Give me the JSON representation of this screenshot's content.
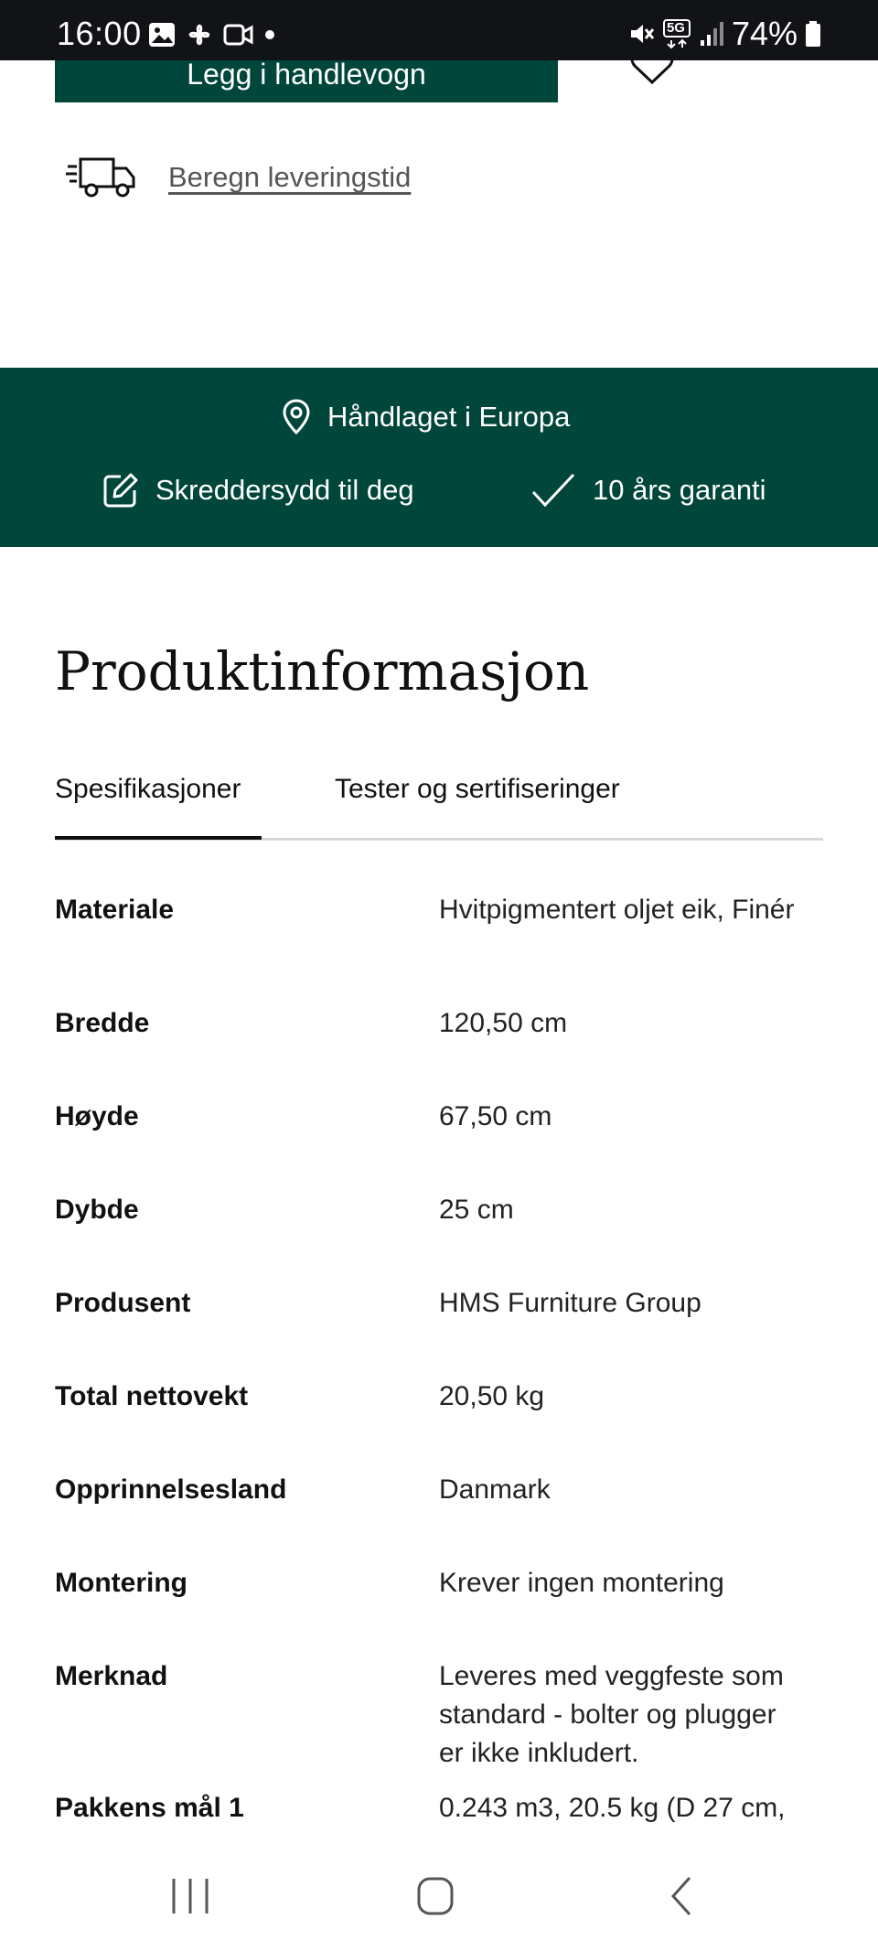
{
  "status_bar": {
    "time": "16:00",
    "battery": "74%",
    "network": "5G"
  },
  "actions": {
    "cart_button_label": "Legg i handlevogn",
    "delivery_link": "Beregn leveringstid"
  },
  "usp": {
    "handmade": "Håndlaget i Europa",
    "tailored": "Skreddersydd til deg",
    "warranty": "10 års garanti"
  },
  "product_info": {
    "title": "Produktinformasjon",
    "tabs": [
      {
        "label": "Spesifikasjoner",
        "active": true
      },
      {
        "label": "Tester og sertifiseringer",
        "active": false
      }
    ],
    "specs": [
      {
        "label": "Materiale",
        "value": "Hvitpigmentert oljet eik, Finér"
      },
      {
        "label": "Bredde",
        "value": "120,50 cm"
      },
      {
        "label": "Høyde",
        "value": "67,50 cm"
      },
      {
        "label": "Dybde",
        "value": "25 cm"
      },
      {
        "label": "Produsent",
        "value": "HMS Furniture Group"
      },
      {
        "label": "Total nettovekt",
        "value": "20,50 kg"
      },
      {
        "label": "Opprinnelsesland",
        "value": "Danmark"
      },
      {
        "label": "Montering",
        "value": "Krever ingen montering"
      },
      {
        "label": "Merknad",
        "value": "Leveres med veggfeste som standard - bolter og plugger er ikke inkludert."
      },
      {
        "label": "Pakkens mål 1",
        "value": "0.243 m3, 20.5 kg (D 27 cm,"
      }
    ]
  },
  "colors": {
    "brand_green": "#00463a",
    "status_bar": "#111316"
  },
  "icons": [
    "image-icon",
    "pinwheel-icon",
    "video-icon",
    "mute-icon",
    "signal-icon",
    "battery-icon",
    "heart-icon",
    "delivery-truck-icon",
    "location-pin-icon",
    "edit-icon",
    "checkmark-icon",
    "recent-apps-icon",
    "home-icon",
    "back-icon"
  ]
}
